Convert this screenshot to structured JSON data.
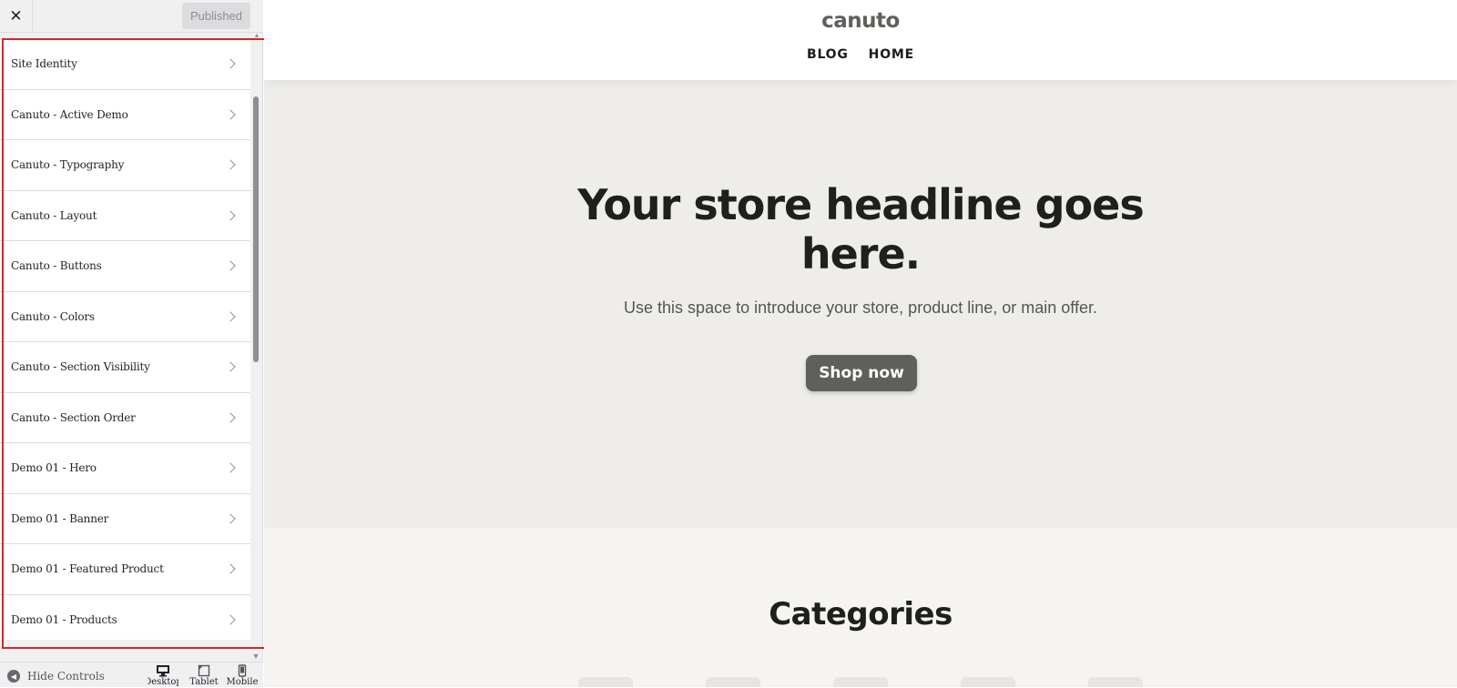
{
  "sidebar": {
    "close_icon": "close-icon",
    "publish_label": "Published",
    "panels": [
      {
        "label": "Site Identity"
      },
      {
        "label": "Canuto - Active Demo"
      },
      {
        "label": "Canuto - Typography"
      },
      {
        "label": "Canuto - Layout"
      },
      {
        "label": "Canuto - Buttons"
      },
      {
        "label": "Canuto - Colors"
      },
      {
        "label": "Canuto - Section Visibility"
      },
      {
        "label": "Canuto - Section Order"
      },
      {
        "label": "Demo 01 - Hero"
      },
      {
        "label": "Demo 01 - Banner"
      },
      {
        "label": "Demo 01 - Featured Product"
      },
      {
        "label": "Demo 01 - Products"
      }
    ],
    "footer": {
      "hide_label": "Hide Controls",
      "devices": [
        {
          "label": "Desktop",
          "icon": "desktop-icon"
        },
        {
          "label": "Tablet",
          "icon": "tablet-icon"
        },
        {
          "label": "Mobile",
          "icon": "mobile-icon"
        }
      ]
    }
  },
  "preview": {
    "site_title": "canuto",
    "nav": [
      "BLOG",
      "HOME"
    ],
    "hero": {
      "headline": "Your store headline goes here.",
      "subtitle": "Use this space to introduce your store, product line, or main offer.",
      "button": "Shop now"
    },
    "section_title": "Categories"
  },
  "colors": {
    "highlight": "#d6242b",
    "button_bg": "#5f605b",
    "hero_bg": "#eeedea",
    "page_bg": "#f5f4f1"
  }
}
